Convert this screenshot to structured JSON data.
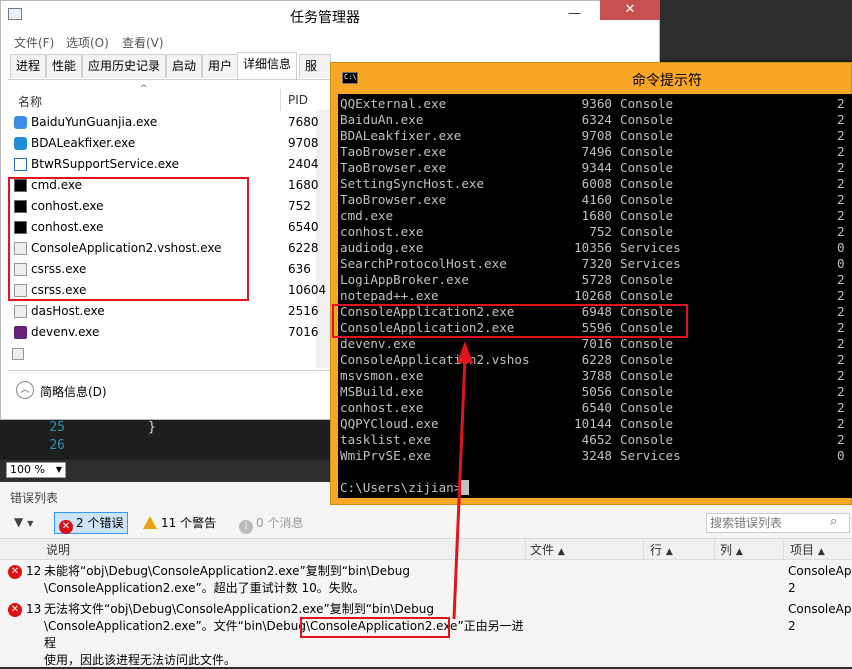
{
  "task_manager": {
    "title": "任务管理器",
    "menu": [
      "文件(F)",
      "选项(O)",
      "查看(V)"
    ],
    "tabs": [
      "进程",
      "性能",
      "应用历史记录",
      "启动",
      "用户",
      "详细信息",
      "服务"
    ],
    "active_tab": "详细信息",
    "columns": {
      "name": "名称",
      "pid": "PID"
    },
    "processes": [
      {
        "name": "BaiduYunGuanjia.exe",
        "pid": "7680",
        "icon": "baiduyun-icon"
      },
      {
        "name": "BDALeakfixer.exe",
        "pid": "9708",
        "icon": "shield-icon"
      },
      {
        "name": "BtwRSupportService.exe",
        "pid": "2404",
        "icon": "window-icon"
      },
      {
        "name": "cmd.exe",
        "pid": "1680",
        "icon": "console-icon"
      },
      {
        "name": "conhost.exe",
        "pid": "752",
        "icon": "console-icon"
      },
      {
        "name": "conhost.exe",
        "pid": "6540",
        "icon": "console-icon"
      },
      {
        "name": "ConsoleApplication2.vshost.exe",
        "pid": "6228",
        "icon": "app-icon"
      },
      {
        "name": "csrss.exe",
        "pid": "636",
        "icon": "app-icon"
      },
      {
        "name": "csrss.exe",
        "pid": "10604",
        "icon": "app-icon"
      },
      {
        "name": "dasHost.exe",
        "pid": "2516",
        "icon": "app-icon"
      },
      {
        "name": "devenv.exe",
        "pid": "7016",
        "icon": "visualstudio-icon"
      }
    ],
    "fewer_details": "简略信息(D)"
  },
  "cmd": {
    "title": "命令提示符",
    "rows": [
      {
        "name": "QQExternal.exe",
        "pid": "9360",
        "session": "Console",
        "num": "2"
      },
      {
        "name": "BaiduAn.exe",
        "pid": "6324",
        "session": "Console",
        "num": "2"
      },
      {
        "name": "BDALeakfixer.exe",
        "pid": "9708",
        "session": "Console",
        "num": "2"
      },
      {
        "name": "TaoBrowser.exe",
        "pid": "7496",
        "session": "Console",
        "num": "2"
      },
      {
        "name": "TaoBrowser.exe",
        "pid": "9344",
        "session": "Console",
        "num": "2"
      },
      {
        "name": "SettingSyncHost.exe",
        "pid": "6008",
        "session": "Console",
        "num": "2"
      },
      {
        "name": "TaoBrowser.exe",
        "pid": "4160",
        "session": "Console",
        "num": "2"
      },
      {
        "name": "cmd.exe",
        "pid": "1680",
        "session": "Console",
        "num": "2"
      },
      {
        "name": "conhost.exe",
        "pid": "752",
        "session": "Console",
        "num": "2"
      },
      {
        "name": "audiodg.exe",
        "pid": "10356",
        "session": "Services",
        "num": "0"
      },
      {
        "name": "SearchProtocolHost.exe",
        "pid": "7320",
        "session": "Services",
        "num": "0"
      },
      {
        "name": "LogiAppBroker.exe",
        "pid": "5728",
        "session": "Console",
        "num": "2"
      },
      {
        "name": "notepad++.exe",
        "pid": "10268",
        "session": "Console",
        "num": "2"
      },
      {
        "name": "ConsoleApplication2.exe",
        "pid": "6948",
        "session": "Console",
        "num": "2"
      },
      {
        "name": "ConsoleApplication2.exe",
        "pid": "5596",
        "session": "Console",
        "num": "2"
      },
      {
        "name": "devenv.exe",
        "pid": "7016",
        "session": "Console",
        "num": "2"
      },
      {
        "name": "ConsoleApplication2.vshos",
        "pid": "6228",
        "session": "Console",
        "num": "2"
      },
      {
        "name": "msvsmon.exe",
        "pid": "3788",
        "session": "Console",
        "num": "2"
      },
      {
        "name": "MSBuild.exe",
        "pid": "5056",
        "session": "Console",
        "num": "2"
      },
      {
        "name": "conhost.exe",
        "pid": "6540",
        "session": "Console",
        "num": "2"
      },
      {
        "name": "QQPYCloud.exe",
        "pid": "10144",
        "session": "Console",
        "num": "2"
      },
      {
        "name": "tasklist.exe",
        "pid": "4652",
        "session": "Console",
        "num": "2"
      },
      {
        "name": "WmiPrvSE.exe",
        "pid": "3248",
        "session": "Services",
        "num": "0"
      }
    ],
    "prompt": "C:\\Users\\zijian>"
  },
  "editor": {
    "line_numbers": [
      "25",
      "26"
    ],
    "code_line": "}",
    "zoom": "100 %"
  },
  "error_list": {
    "title": "错误列表",
    "errors_btn": "2 个错误",
    "warnings_btn": "11 个警告",
    "messages_btn": "0 个消息",
    "search_placeholder": "搜索错误列表",
    "columns": {
      "desc": "说明",
      "file": "文件",
      "line": "行",
      "col": "列",
      "project": "项目"
    },
    "rows": [
      {
        "num": "12",
        "line1": "未能将“obj\\Debug\\ConsoleApplication2.exe”复制到“bin\\Debug",
        "line2": "\\ConsoleApplication2.exe”。超出了重试计数 10。失败。",
        "project1": "ConsoleAp",
        "project2": "2"
      },
      {
        "num": "13",
        "line1": "无法将文件“obj\\Debug\\ConsoleApplication2.exe”复制到“bin\\Debug",
        "line2a": "\\ConsoleApplication2.exe”。文件“bin\\Debug\\",
        "line2b": "ConsoleApplication2.exe",
        "line2c": "”正由另一进程",
        "line3": "使用，因此该进程无法访问此文件。",
        "project1": "ConsoleAp",
        "project2": "2"
      }
    ]
  },
  "colors": {
    "highlight": "#e0141e",
    "cmd_title_bg": "#f7a625",
    "error_icon": "#dd1111",
    "warning_icon": "#e8a317"
  }
}
